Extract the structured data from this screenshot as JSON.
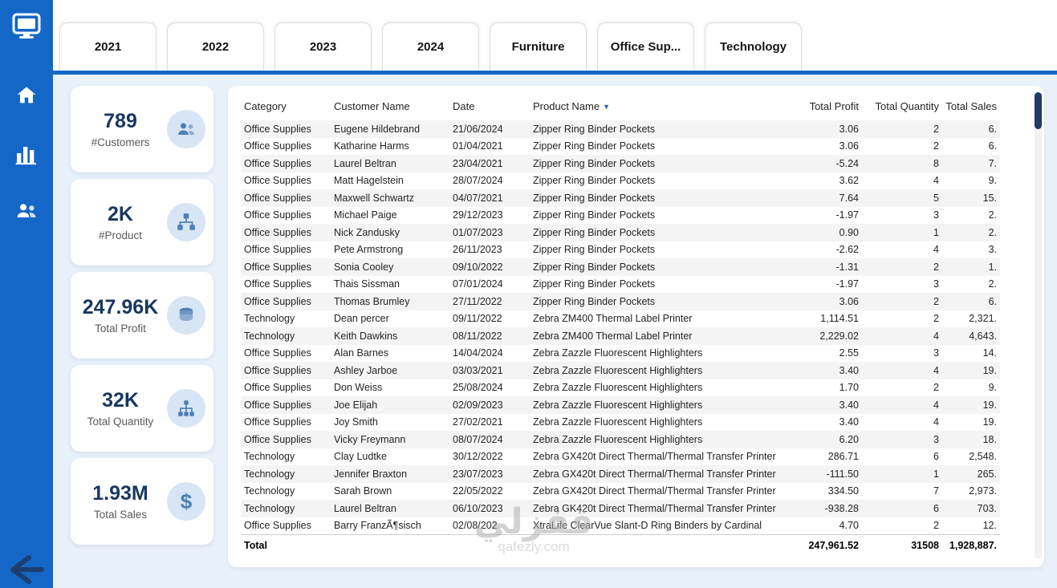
{
  "tabs": [
    "2021",
    "2022",
    "2023",
    "2024",
    "Furniture",
    "Office Sup...",
    "Technology"
  ],
  "sidebar": {
    "icons": [
      "monitor-logo-icon",
      "home-icon",
      "bar-chart-icon",
      "people-icon",
      "back-arrow-icon"
    ]
  },
  "kpis": [
    {
      "value": "789",
      "label": "#Customers",
      "icon": "customers-icon"
    },
    {
      "value": "2K",
      "label": "#Product",
      "icon": "product-network-icon"
    },
    {
      "value": "247.96K",
      "label": "Total Profit",
      "icon": "coins-icon"
    },
    {
      "value": "32K",
      "label": "Total Quantity",
      "icon": "hierarchy-icon"
    },
    {
      "value": "1.93M",
      "label": "Total Sales",
      "icon": "dollar-icon"
    }
  ],
  "table": {
    "columns": [
      "Category",
      "Customer Name",
      "Date",
      "Product Name",
      "Total Profit",
      "Total Quantity",
      "Total Sales"
    ],
    "sorted_column": "Product Name",
    "rows": [
      [
        "Office Supplies",
        "Eugene Hildebrand",
        "21/06/2024",
        "Zipper Ring Binder Pockets",
        "3.06",
        "2",
        "6."
      ],
      [
        "Office Supplies",
        "Katharine Harms",
        "01/04/2021",
        "Zipper Ring Binder Pockets",
        "3.06",
        "2",
        "6."
      ],
      [
        "Office Supplies",
        "Laurel Beltran",
        "23/04/2021",
        "Zipper Ring Binder Pockets",
        "-5.24",
        "8",
        "7."
      ],
      [
        "Office Supplies",
        "Matt Hagelstein",
        "28/07/2024",
        "Zipper Ring Binder Pockets",
        "3.62",
        "4",
        "9."
      ],
      [
        "Office Supplies",
        "Maxwell Schwartz",
        "04/07/2021",
        "Zipper Ring Binder Pockets",
        "7.64",
        "5",
        "15."
      ],
      [
        "Office Supplies",
        "Michael Paige",
        "29/12/2023",
        "Zipper Ring Binder Pockets",
        "-1.97",
        "3",
        "2."
      ],
      [
        "Office Supplies",
        "Nick Zandusky",
        "01/07/2023",
        "Zipper Ring Binder Pockets",
        "0.90",
        "1",
        "2."
      ],
      [
        "Office Supplies",
        "Pete Armstrong",
        "26/11/2023",
        "Zipper Ring Binder Pockets",
        "-2.62",
        "4",
        "3."
      ],
      [
        "Office Supplies",
        "Sonia Cooley",
        "09/10/2022",
        "Zipper Ring Binder Pockets",
        "-1.31",
        "2",
        "1."
      ],
      [
        "Office Supplies",
        "Thais Sissman",
        "07/01/2024",
        "Zipper Ring Binder Pockets",
        "-1.97",
        "3",
        "2."
      ],
      [
        "Office Supplies",
        "Thomas Brumley",
        "27/11/2022",
        "Zipper Ring Binder Pockets",
        "3.06",
        "2",
        "6."
      ],
      [
        "Technology",
        "Dean percer",
        "09/11/2022",
        "Zebra ZM400 Thermal Label Printer",
        "1,114.51",
        "2",
        "2,321."
      ],
      [
        "Technology",
        "Keith Dawkins",
        "08/11/2022",
        "Zebra ZM400 Thermal Label Printer",
        "2,229.02",
        "4",
        "4,643."
      ],
      [
        "Office Supplies",
        "Alan Barnes",
        "14/04/2024",
        "Zebra Zazzle Fluorescent Highlighters",
        "2.55",
        "3",
        "14."
      ],
      [
        "Office Supplies",
        "Ashley Jarboe",
        "03/03/2021",
        "Zebra Zazzle Fluorescent Highlighters",
        "3.40",
        "4",
        "19."
      ],
      [
        "Office Supplies",
        "Don Weiss",
        "25/08/2024",
        "Zebra Zazzle Fluorescent Highlighters",
        "1.70",
        "2",
        "9."
      ],
      [
        "Office Supplies",
        "Joe Elijah",
        "02/09/2023",
        "Zebra Zazzle Fluorescent Highlighters",
        "3.40",
        "4",
        "19."
      ],
      [
        "Office Supplies",
        "Joy Smith",
        "27/02/2021",
        "Zebra Zazzle Fluorescent Highlighters",
        "3.40",
        "4",
        "19."
      ],
      [
        "Office Supplies",
        "Vicky Freymann",
        "08/07/2024",
        "Zebra Zazzle Fluorescent Highlighters",
        "6.20",
        "3",
        "18."
      ],
      [
        "Technology",
        "Clay Ludtke",
        "30/12/2022",
        "Zebra GX420t Direct Thermal/Thermal Transfer Printer",
        "286.71",
        "6",
        "2,548."
      ],
      [
        "Technology",
        "Jennifer Braxton",
        "23/07/2023",
        "Zebra GX420t Direct Thermal/Thermal Transfer Printer",
        "-111.50",
        "1",
        "265."
      ],
      [
        "Technology",
        "Sarah Brown",
        "22/05/2022",
        "Zebra GX420t Direct Thermal/Thermal Transfer Printer",
        "334.50",
        "7",
        "2,973."
      ],
      [
        "Technology",
        "Laurel Beltran",
        "06/10/2023",
        "Zebra GK420t Direct Thermal/Thermal Transfer Printer",
        "-938.28",
        "6",
        "703."
      ],
      [
        "Office Supplies",
        "Barry FranzÃ¶sisch",
        "02/08/202",
        "XtraLife ClearVue Slant-D Ring Binders by Cardinal",
        "4.70",
        "2",
        "12."
      ]
    ],
    "total": {
      "label": "Total",
      "profit": "247,961.52",
      "quantity": "31508",
      "sales": "1,928,887."
    }
  },
  "watermark": {
    "text": "قفزلي",
    "subtext": "qafezly.com"
  },
  "colors": {
    "sidebar": "#1467c6",
    "accent_navy": "#17375e",
    "icon_circle": "#d7e5f5",
    "icon_glyph": "#4d7fb5"
  }
}
